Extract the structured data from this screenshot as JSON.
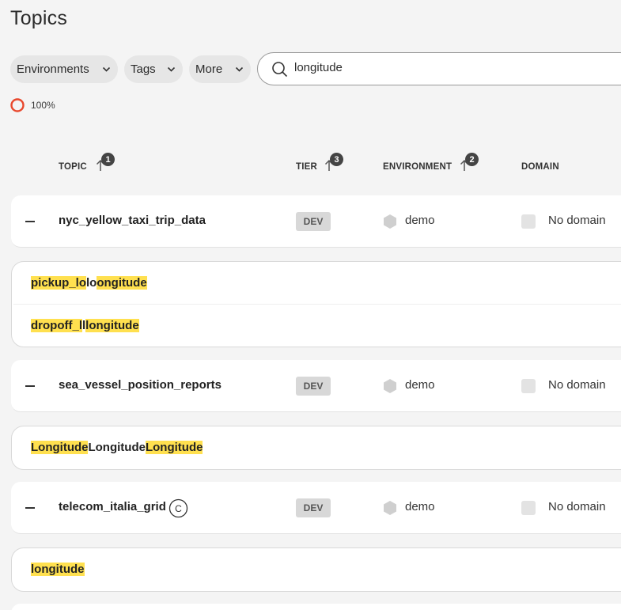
{
  "page": {
    "title": "Topics"
  },
  "filters": {
    "environments": "Environments",
    "tags": "Tags",
    "more": "More"
  },
  "search": {
    "value": "longitude"
  },
  "progress": {
    "label": "100%",
    "value": 1.0,
    "color": "#e8482d"
  },
  "columns": {
    "topic": "TOPIC",
    "topic_sort_order": "1",
    "tier": "TIER",
    "tier_sort_order": "3",
    "environment": "ENVIRONMENT",
    "environment_sort_order": "2",
    "domain": "DOMAIN"
  },
  "rows": [
    {
      "name": "nyc_yellow_taxi_trip_data",
      "tier": "DEV",
      "environment": "demo",
      "domain": "No domain",
      "fields": [
        {
          "parts": [
            {
              "text": "pickup_lo",
              "hl": true
            },
            {
              "text": "lo",
              "hl": false
            },
            {
              "text": "ongitude",
              "hl": true
            }
          ]
        },
        {
          "parts": [
            {
              "text": "dropoff_l",
              "hl": true
            },
            {
              "text": "l",
              "hl": false
            },
            {
              "text": "longitude",
              "hl": true
            }
          ]
        }
      ]
    },
    {
      "name": "sea_vessel_position_reports",
      "tier": "DEV",
      "environment": "demo",
      "domain": "No domain",
      "fields": [
        {
          "parts": [
            {
              "text": "Longitude",
              "hl": true
            },
            {
              "text": "Longitude",
              "hl": false
            },
            {
              "text": "Longitude",
              "hl": true
            }
          ]
        }
      ]
    },
    {
      "name": "telecom_italia_grid",
      "badge": "C",
      "tier": "DEV",
      "environment": "demo",
      "domain": "No domain",
      "fields": [
        {
          "parts": [
            {
              "text": "longitude",
              "hl": true
            }
          ]
        }
      ]
    }
  ],
  "colors": {
    "highlight": "#ffe04f",
    "background": "#f4f4f4",
    "tier_badge": "#d8d8d8"
  },
  "icons": {
    "search": "search-icon",
    "chevron": "chevron-down-icon",
    "sort": "arrow-up-icon",
    "environment": "hexagon-icon",
    "collapse": "minus-icon",
    "compacted": "c-circle-icon"
  }
}
